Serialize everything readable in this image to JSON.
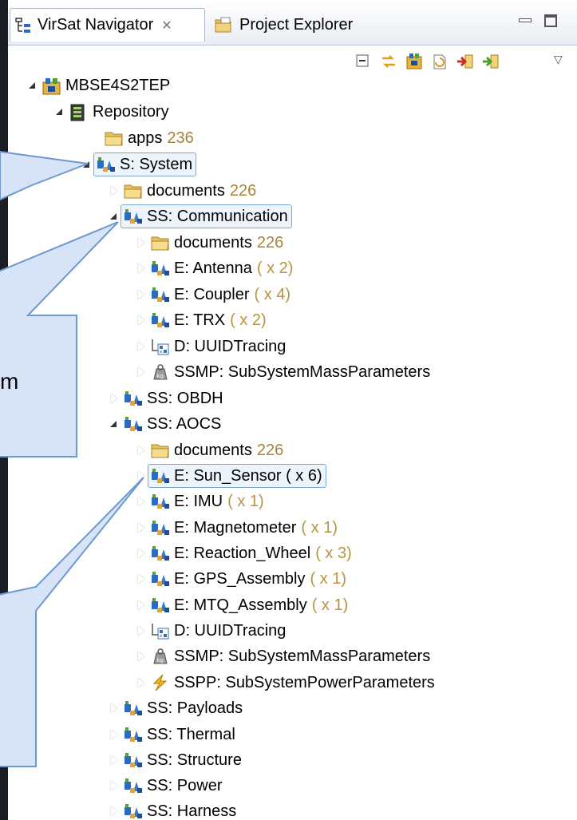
{
  "tabs": {
    "navigator": "VirSat Navigator",
    "navigator_close": "✕",
    "explorer": "Project Explorer"
  },
  "callout_fragment": "m",
  "tree": [
    {
      "label": "MBSE4S2TEP",
      "icon": "project-icon",
      "twisty": "open"
    },
    {
      "label": "Repository",
      "icon": "repository-icon",
      "twisty": "open"
    },
    {
      "label": "apps",
      "count": "236",
      "icon": "folder-icon",
      "twisty": "none"
    },
    {
      "label": "S: System",
      "icon": "element-icon",
      "twisty": "open",
      "selected": true
    },
    {
      "label": "documents",
      "count": "226",
      "icon": "folder-icon",
      "twisty": "closed"
    },
    {
      "label": "SS: Communication",
      "icon": "element-icon",
      "twisty": "open",
      "selected": true
    },
    {
      "label": "documents",
      "count": "226",
      "icon": "folder-icon",
      "twisty": "closed"
    },
    {
      "label": "E: Antenna",
      "mult": "( x 2)",
      "icon": "element-icon",
      "twisty": "closed"
    },
    {
      "label": "E: Coupler",
      "mult": "( x 4)",
      "icon": "element-icon",
      "twisty": "closed"
    },
    {
      "label": "E: TRX",
      "mult": "( x 2)",
      "icon": "element-icon",
      "twisty": "closed"
    },
    {
      "label": "D: UUIDTracing",
      "icon": "tracing-icon",
      "twisty": "closed"
    },
    {
      "label": "SSMP: SubSystemMassParameters",
      "icon": "mass-icon",
      "twisty": "closed"
    },
    {
      "label": "SS: OBDH",
      "icon": "element-icon",
      "twisty": "closed"
    },
    {
      "label": "SS: AOCS",
      "icon": "element-icon",
      "twisty": "open"
    },
    {
      "label": "documents",
      "count": "226",
      "icon": "folder-icon",
      "twisty": "closed"
    },
    {
      "label": "E: Sun_Sensor ( x 6)",
      "icon": "element-icon",
      "twisty": "closed",
      "selected": true
    },
    {
      "label": "E: IMU",
      "mult": "( x 1)",
      "icon": "element-icon",
      "twisty": "closed"
    },
    {
      "label": "E: Magnetometer",
      "mult": "( x 1)",
      "icon": "element-icon",
      "twisty": "closed"
    },
    {
      "label": "E: Reaction_Wheel",
      "mult": "( x 3)",
      "icon": "element-icon",
      "twisty": "closed"
    },
    {
      "label": "E: GPS_Assembly",
      "mult": "( x 1)",
      "icon": "element-icon",
      "twisty": "closed"
    },
    {
      "label": "E: MTQ_Assembly",
      "mult": "( x 1)",
      "icon": "element-icon",
      "twisty": "closed"
    },
    {
      "label": "D: UUIDTracing",
      "icon": "tracing-icon",
      "twisty": "closed"
    },
    {
      "label": "SSMP: SubSystemMassParameters",
      "icon": "mass-icon",
      "twisty": "closed"
    },
    {
      "label": "SSPP: SubSystemPowerParameters",
      "icon": "power-icon",
      "twisty": "closed"
    },
    {
      "label": "SS: Payloads",
      "icon": "element-icon",
      "twisty": "closed"
    },
    {
      "label": "SS: Thermal",
      "icon": "element-icon",
      "twisty": "closed"
    },
    {
      "label": "SS: Structure",
      "icon": "element-icon",
      "twisty": "closed"
    },
    {
      "label": "SS: Power",
      "icon": "element-icon",
      "twisty": "closed"
    },
    {
      "label": "SS: Harness",
      "icon": "element-icon",
      "twisty": "closed"
    }
  ]
}
